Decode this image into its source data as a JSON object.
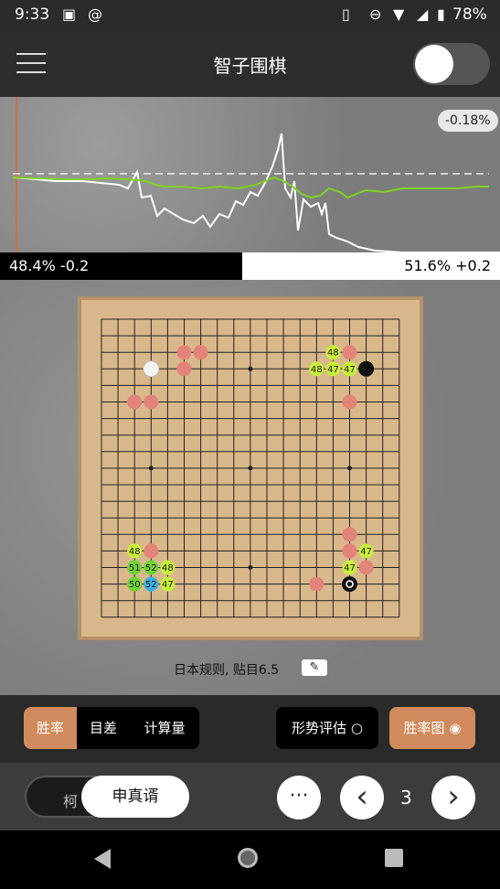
{
  "status_bar": {
    "time": "9:33",
    "battery": "78%",
    "icons": [
      "image-icon",
      "at-icon",
      "vibrate-icon",
      "dnd-icon",
      "wifi-icon",
      "signal-icon",
      "battery-icon"
    ]
  },
  "app_bar": {
    "title": "智子围棋",
    "toggle_on": false
  },
  "graph": {
    "badge": "-0.18%"
  },
  "score": {
    "black_text": "48.4% -0.2",
    "white_text": "51.6% +0.2",
    "black_share": 0.484
  },
  "board": {
    "size": 19,
    "black_stones": [
      [
        16,
        3
      ],
      [
        15,
        16
      ]
    ],
    "white_stones": [
      [
        3,
        3
      ]
    ],
    "last_move": [
      15,
      16
    ],
    "red_marks": [
      [
        5,
        2
      ],
      [
        6,
        2
      ],
      [
        5,
        3
      ],
      [
        2,
        5
      ],
      [
        3,
        5
      ],
      [
        15,
        2
      ],
      [
        15,
        5
      ],
      [
        15,
        13
      ],
      [
        15,
        14
      ],
      [
        16,
        15
      ],
      [
        13,
        16
      ],
      [
        3,
        14
      ]
    ],
    "labels": [
      {
        "pt": [
          14,
          2
        ],
        "text": "48",
        "color": "#c8f03c"
      },
      {
        "pt": [
          13,
          3
        ],
        "text": "48",
        "color": "#c8f03c"
      },
      {
        "pt": [
          14,
          3
        ],
        "text": "47",
        "color": "#c8f03c"
      },
      {
        "pt": [
          15,
          3
        ],
        "text": "47",
        "color": "#c8f03c"
      },
      {
        "pt": [
          2,
          14
        ],
        "text": "48",
        "color": "#c8f03c"
      },
      {
        "pt": [
          2,
          15
        ],
        "text": "51",
        "color": "#6fd33a"
      },
      {
        "pt": [
          3,
          15
        ],
        "text": "52",
        "color": "#6fd33a"
      },
      {
        "pt": [
          4,
          15
        ],
        "text": "48",
        "color": "#c8f03c"
      },
      {
        "pt": [
          2,
          16
        ],
        "text": "50",
        "color": "#6fd33a"
      },
      {
        "pt": [
          3,
          16
        ],
        "text": "52",
        "color": "#3bb0e0"
      },
      {
        "pt": [
          4,
          16
        ],
        "text": "47",
        "color": "#c8f03c"
      },
      {
        "pt": [
          16,
          14
        ],
        "text": "47",
        "color": "#c8f03c"
      },
      {
        "pt": [
          15,
          15
        ],
        "text": "47",
        "color": "#c8f03c"
      }
    ],
    "rules": "日本规则, 贴目6.5"
  },
  "controls": {
    "seg_winrate": "胜率",
    "seg_diff": "目差",
    "seg_calc": "计算量",
    "eval_label": "形势评估",
    "chart_label": "胜率图"
  },
  "bottom": {
    "name_back": "柯",
    "name_front": "申真谞",
    "more": "···",
    "prev": "‹",
    "next": "›",
    "move_number": "3"
  },
  "colors": {
    "accent": "#d08a5c",
    "winrate_line": "#7ed321",
    "score_line": "#ffffff"
  }
}
